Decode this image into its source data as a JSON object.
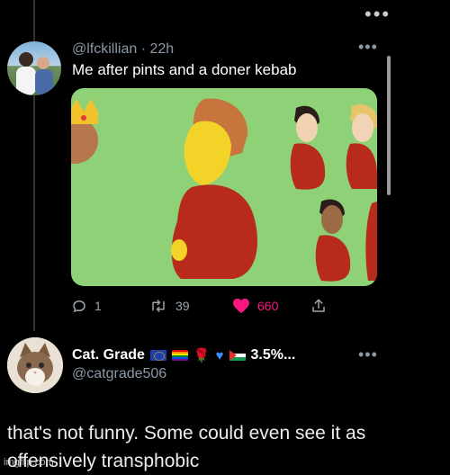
{
  "top_menu": {
    "icon": "more-horizontal-icon",
    "text": "•••"
  },
  "tweet": {
    "handle": "@lfckillian",
    "separator": "·",
    "time": "22h",
    "text": "Me after pints and a doner kebab",
    "more": "•••",
    "actions": {
      "reply_count": "1",
      "retweet_count": "39",
      "like_count": "660"
    }
  },
  "reply": {
    "name": "Cat. Grade",
    "name_suffix": "3.5%...",
    "handle": "@catgrade506",
    "more": "•••",
    "text": "that's not funny.  Some could even see it as offensively transphobic"
  },
  "watermark": "imgflip.com",
  "colors": {
    "background": "#000000",
    "secondary_text": "#8b98a5",
    "like": "#f91880",
    "image_bg": "#8fd177"
  }
}
